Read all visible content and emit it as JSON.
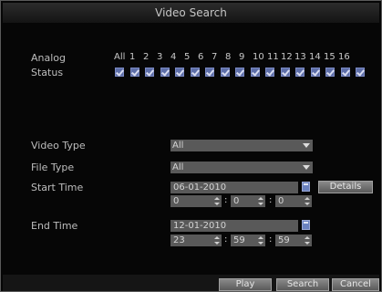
{
  "window": {
    "title": "Video Search"
  },
  "labels": {
    "analog": "Analog",
    "status": "Status",
    "video_type": "Video Type",
    "file_type": "File Type",
    "start_time": "Start Time",
    "end_time": "End Time"
  },
  "channels": {
    "all_label": "All",
    "numbers": [
      "1",
      "2",
      "3",
      "4",
      "5",
      "6",
      "7",
      "8",
      "9",
      "10",
      "11",
      "12",
      "13",
      "14",
      "15",
      "16"
    ],
    "status_checked": [
      true,
      true,
      true,
      true,
      true,
      true,
      true,
      true,
      true,
      true,
      true,
      true,
      true,
      true,
      true,
      true,
      true
    ]
  },
  "video_type": {
    "value": "All"
  },
  "file_type": {
    "value": "All"
  },
  "start": {
    "date": "06-01-2010",
    "hour": "0",
    "minute": "0",
    "second": "0"
  },
  "end": {
    "date": "12-01-2010",
    "hour": "23",
    "minute": "59",
    "second": "59"
  },
  "buttons": {
    "details": "Details",
    "play": "Play",
    "search": "Search",
    "cancel": "Cancel"
  },
  "icons": {
    "calendar": "calendar-icon",
    "dropdown": "chevron-down-icon",
    "spinner": "spinner-arrows-icon",
    "checkbox": "checkbox-checked-icon"
  }
}
